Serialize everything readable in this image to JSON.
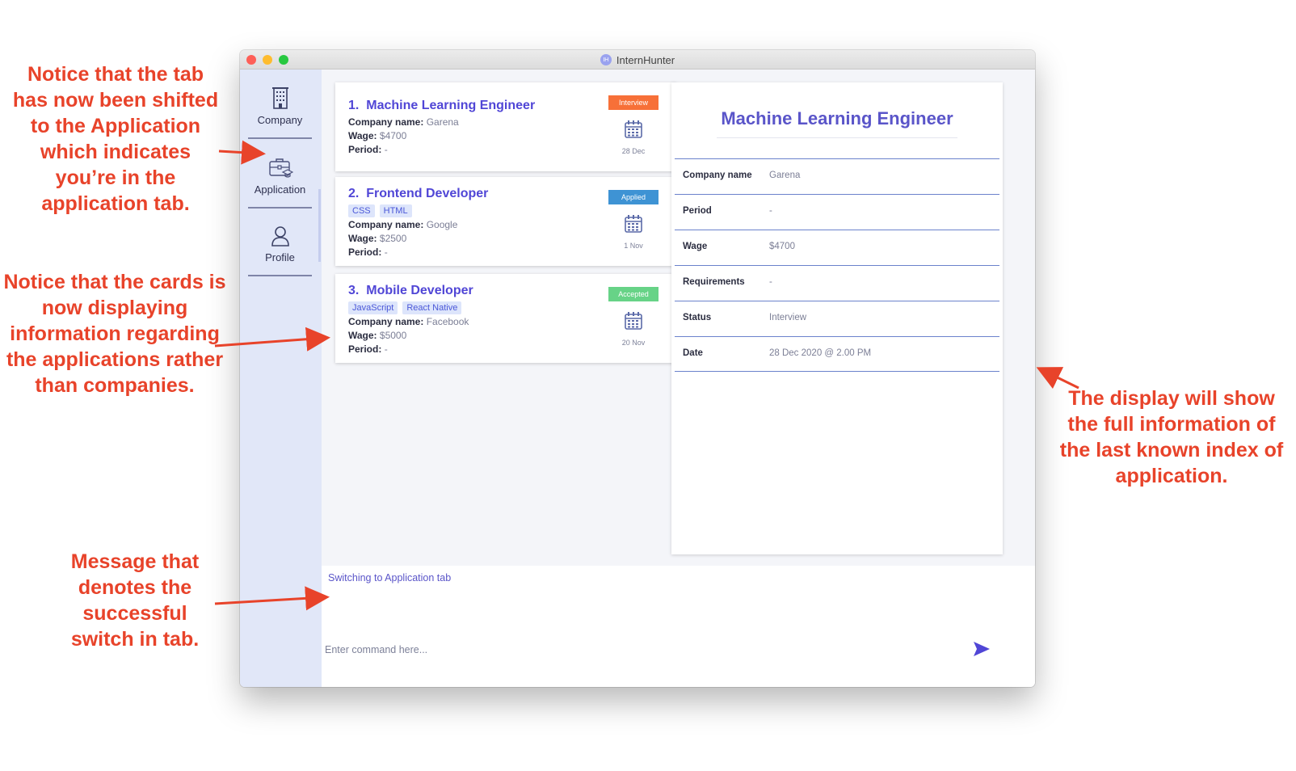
{
  "annotations": {
    "tab_shift": "Notice that the tab has now been shifted to the Application which indicates you’re in the application tab.",
    "cards": "Notice that the cards is now displaying information regarding the applications rather than companies.",
    "message": "Message that denotes the successful switch in tab.",
    "display": "The display will show the full information of the last known index of application.",
    "color": "#e8432a"
  },
  "window": {
    "title": "InternHunter",
    "app_icon": "IH"
  },
  "sidebar": {
    "active": "Application",
    "items": [
      {
        "label": "Company",
        "icon": "building-icon"
      },
      {
        "label": "Application",
        "icon": "briefcase-icon"
      },
      {
        "label": "Profile",
        "icon": "user-icon"
      }
    ]
  },
  "cards": [
    {
      "index": "1.",
      "title": "Machine Learning Engineer",
      "tags": [],
      "company_label": "Company name:",
      "company": "Garena",
      "wage_label": "Wage:",
      "wage": "$4700",
      "period_label": "Period:",
      "period": "-",
      "status": "Interview",
      "date": "28 Dec"
    },
    {
      "index": "2.",
      "title": "Frontend Developer",
      "tags": [
        "CSS",
        "HTML"
      ],
      "company_label": "Company name:",
      "company": "Google",
      "wage_label": "Wage:",
      "wage": "$2500",
      "period_label": "Period:",
      "period": "-",
      "status": "Applied",
      "date": "1 Nov"
    },
    {
      "index": "3.",
      "title": "Mobile Developer",
      "tags": [
        "JavaScript",
        "React Native"
      ],
      "company_label": "Company name:",
      "company": "Facebook",
      "wage_label": "Wage:",
      "wage": "$5000",
      "period_label": "Period:",
      "period": "-",
      "status": "Accepted",
      "date": "20 Nov"
    }
  ],
  "detail": {
    "title": "Machine Learning Engineer",
    "rows": [
      {
        "label": "Company name",
        "value": "Garena"
      },
      {
        "label": "Period",
        "value": "-"
      },
      {
        "label": "Wage",
        "value": "$4700"
      },
      {
        "label": "Requirements",
        "value": "-"
      },
      {
        "label": "Status",
        "value": "Interview"
      },
      {
        "label": "Date",
        "value": "28 Dec 2020 @ 2.00 PM"
      }
    ]
  },
  "result": {
    "message": "Switching to Application tab"
  },
  "command": {
    "placeholder": "Enter command here...",
    "value": ""
  },
  "colors": {
    "accent": "#5046d6",
    "interview": "#f77038",
    "applied": "#3e93d4",
    "accepted": "#67d387"
  }
}
